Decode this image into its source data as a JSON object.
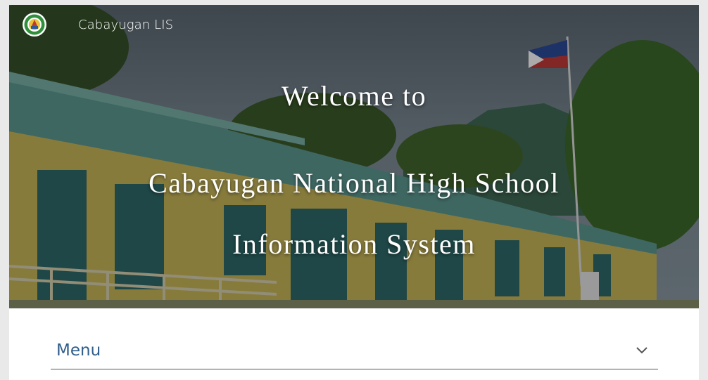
{
  "brand": {
    "name": "Cabayugan LIS",
    "logo_icon": "school-seal-icon"
  },
  "hero": {
    "line1": "Welcome to",
    "line2": "Cabayugan National High School",
    "line3": "Information System"
  },
  "menu": {
    "label": "Menu",
    "toggle_icon": "chevron-down-icon"
  },
  "colors": {
    "menu_text": "#2f5e8a",
    "hero_text": "#ffffff",
    "divider": "#555555"
  }
}
